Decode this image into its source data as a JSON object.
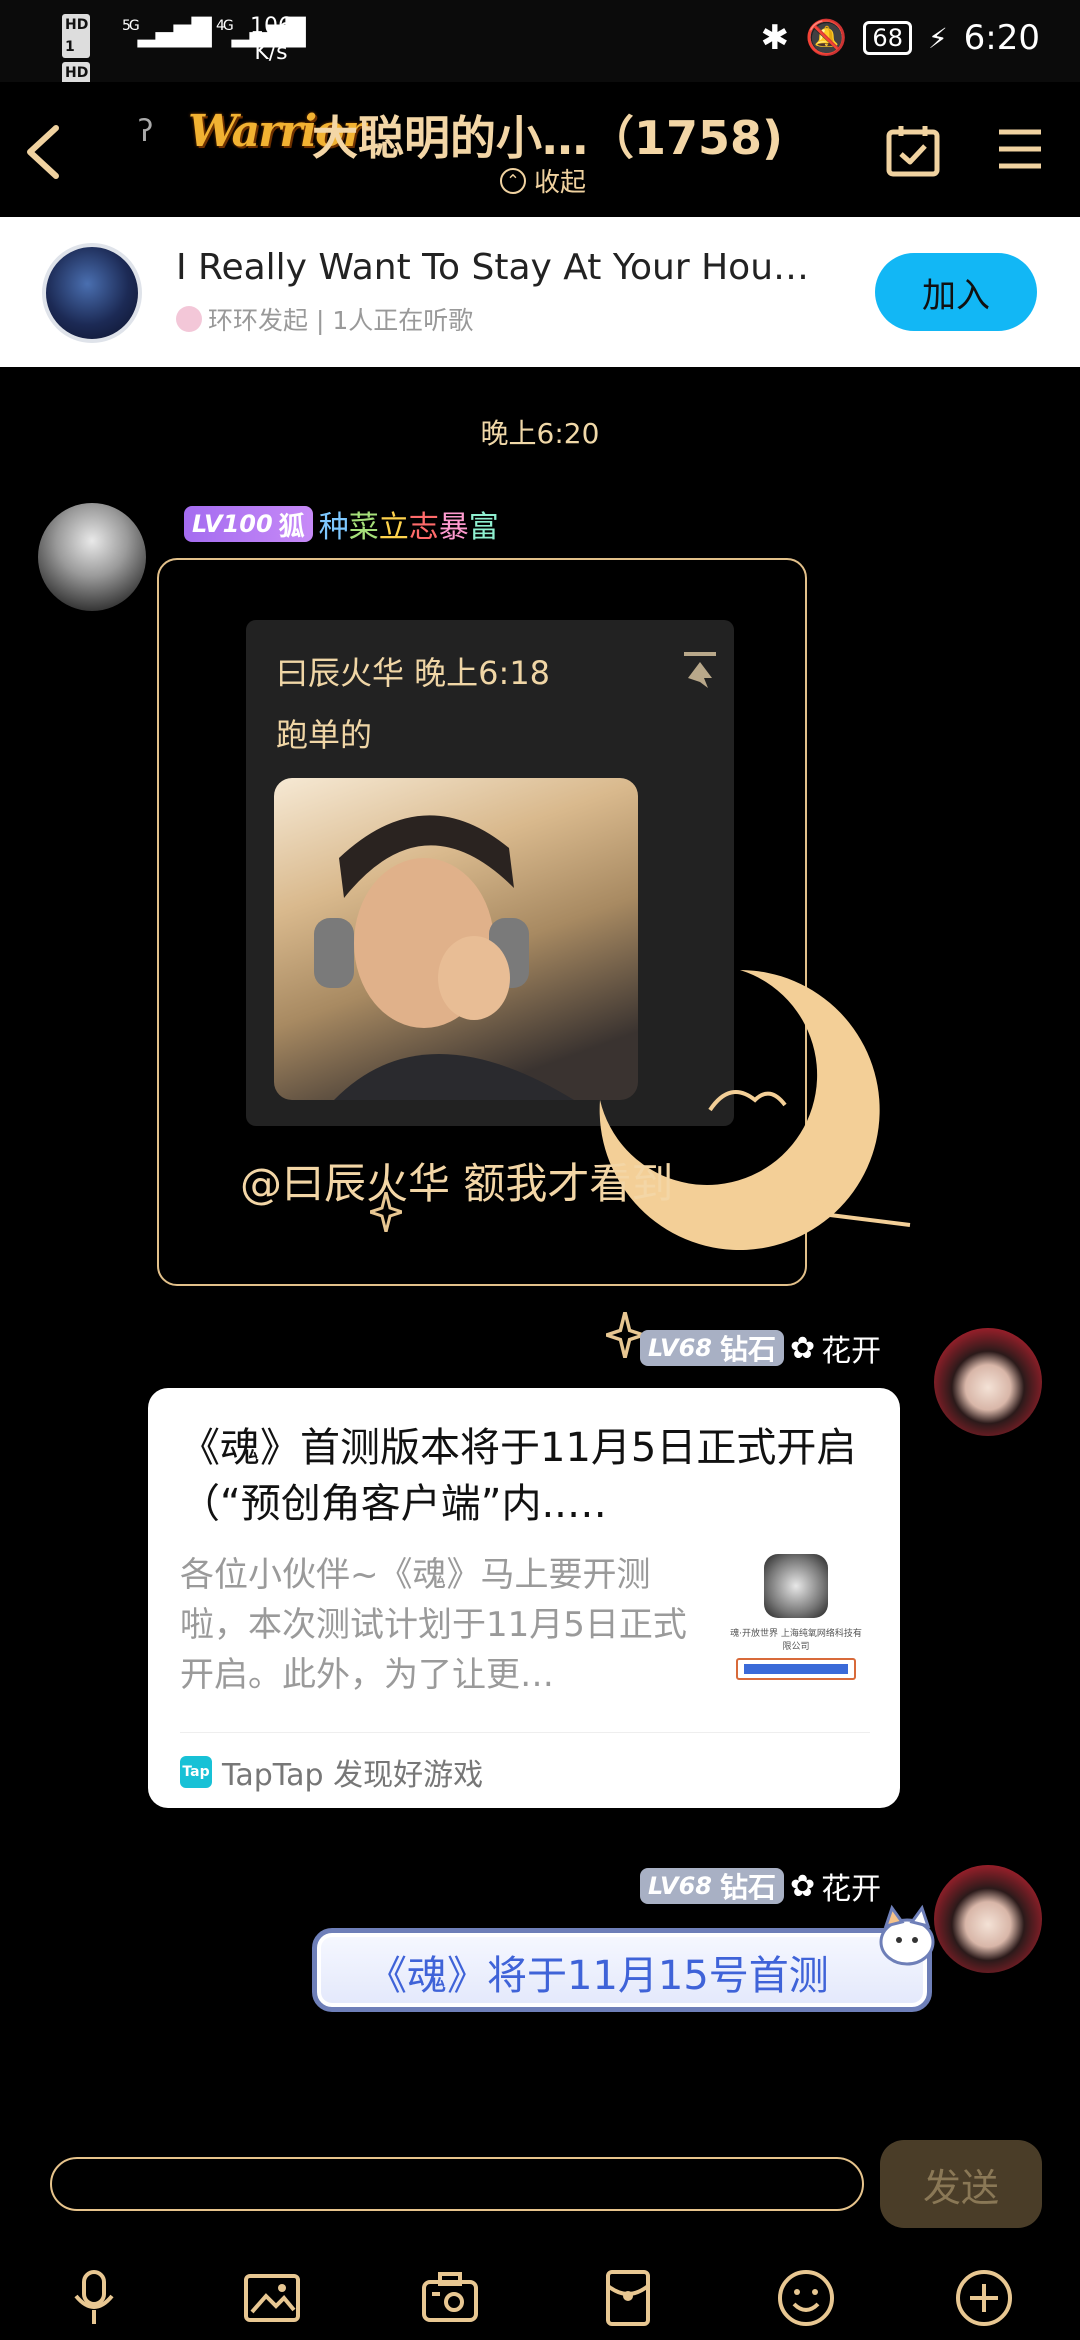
{
  "status_bar": {
    "hd1": "HD 1",
    "hd2": "HD 2",
    "net1": "5G",
    "net2": "4G",
    "speed_value": "106",
    "speed_unit": "K/s",
    "battery": "68",
    "time": "6:20"
  },
  "header": {
    "logo_text": "Warrior",
    "title": "大聪明的小…（1758)",
    "collapse_label": "收起"
  },
  "music_banner": {
    "song_title": "I Really Want To Stay At Your Hou…",
    "subtitle": "环环发起 | 1人正在听歌",
    "join_label": "加入"
  },
  "chat": {
    "time_separator": "晚上6:20",
    "msg1": {
      "level": "LV100",
      "badge": "狐",
      "nickname_chars": [
        "种",
        "菜",
        "立",
        "志",
        "暴",
        "富"
      ],
      "quote_author_time": "曰辰火华 晚上6:18",
      "quote_text": "跑单的",
      "reply_text": "@曰辰火华 额我才看到"
    },
    "msg2": {
      "level": "LV68",
      "tag": "钻石",
      "nickname": "花开",
      "card_title": "《魂》首测版本将于11月5日正式开启（“预创角客户端”内..…",
      "card_desc": "各位小伙伴~《魂》马上要开测啦，本次测试计划于11月5日正式开启。此外，为了让更…",
      "card_source": "TapTap 发现好游戏",
      "thumb_caption": "魂·开放世界 上海纯氧网络科技有限公司",
      "thumb_button": "View in TapTap"
    },
    "msg3": {
      "level": "LV68",
      "tag": "钻石",
      "nickname": "花开",
      "text": "《魂》将于11月15号首测"
    }
  },
  "input_bar": {
    "placeholder": "",
    "send_label": "发送"
  },
  "toolbar": {
    "icons": [
      "microphone-icon",
      "image-icon",
      "camera-icon",
      "red-packet-icon",
      "emoji-icon",
      "plus-icon"
    ]
  },
  "colors": {
    "background": "#000000",
    "accent_gold": "#e8c792",
    "join_blue": "#12b7f5",
    "level_purple": "#b07af3",
    "level_gray": "#a8b0c4"
  }
}
